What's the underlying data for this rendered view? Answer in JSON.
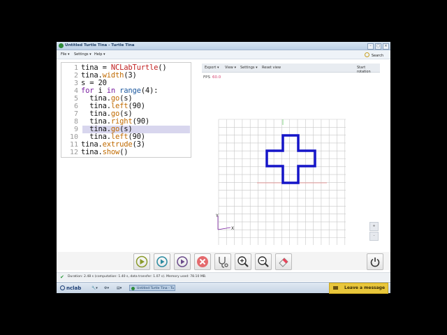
{
  "window": {
    "title": "Untitled Turtle Tina - Turtle Tina",
    "controls": [
      "–",
      "□",
      "×"
    ]
  },
  "menu": {
    "file": "File ▾",
    "settings": "Settings ▾",
    "help": "Help ▾",
    "search": "Search"
  },
  "editor": {
    "lines": [
      {
        "n": "1",
        "text": "tina = NCLabTurtle()"
      },
      {
        "n": "2",
        "text": "tina.width(3)"
      },
      {
        "n": "3",
        "text": "s = 20"
      },
      {
        "n": "4",
        "text": "for i in range(4):"
      },
      {
        "n": "5",
        "text": "  tina.go(s)"
      },
      {
        "n": "6",
        "text": "  tina.left(90)"
      },
      {
        "n": "7",
        "text": "  tina.go(s)"
      },
      {
        "n": "8",
        "text": "  tina.right(90)"
      },
      {
        "n": "9",
        "text": "  tina.go(s)"
      },
      {
        "n": "10",
        "text": "  tina.left(90)"
      },
      {
        "n": "11",
        "text": "tina.extrude(3)"
      },
      {
        "n": "12",
        "text": "tina.show()"
      }
    ],
    "highlighted_line": "9"
  },
  "viewer": {
    "toolbar": {
      "export": "Export ▾",
      "view": "View ▾",
      "settings": "Settings ▾",
      "reset": "Reset view",
      "rotation": "Start rotation"
    },
    "fps_label": "FPS",
    "fps_value": "60.0",
    "axis_y": "Y",
    "axis_x": "X",
    "shape_color": "#1515c8",
    "zoom_plus": "+",
    "zoom_minus": "-"
  },
  "toolbar_buttons": [
    "play-icon",
    "step-icon",
    "run-icon",
    "stop-icon",
    "stethoscope-icon",
    "zoom-in-icon",
    "zoom-out-icon",
    "eraser-icon",
    "power-icon"
  ],
  "status": {
    "text": "Duration: 2.48 s (computation: 1.40 s, data transfer: 1.07 s). Memory used: 78.10 MB."
  },
  "taskbar": {
    "logo": "nclab",
    "task_label": "Untitled Turtle Tina - Tu",
    "leave_message": "Leave a message"
  },
  "colors": {
    "accent_yellow": "#e9c73b",
    "play_green": "#2e9b36",
    "stop_red": "#d9474b"
  }
}
